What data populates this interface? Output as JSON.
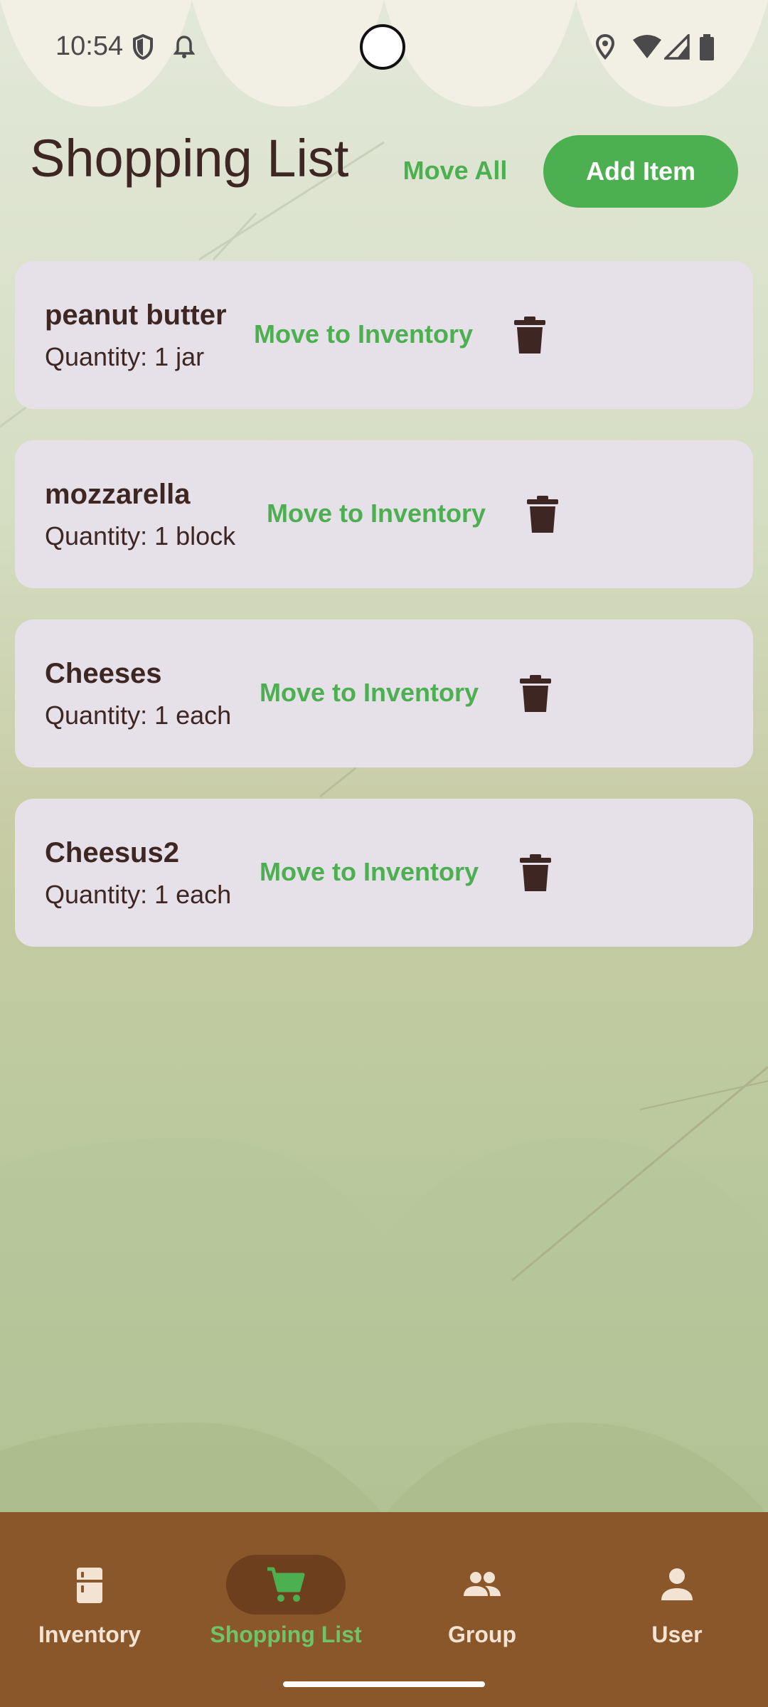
{
  "status_bar": {
    "time": "10:54",
    "icons": [
      "shield-icon",
      "bell-icon",
      "location-icon",
      "wifi-icon",
      "signal-icon",
      "battery-icon"
    ]
  },
  "header": {
    "title": "Shopping List",
    "move_all_label": "Move All",
    "add_item_label": "Add Item"
  },
  "items": [
    {
      "name": "peanut butter",
      "quantity": "Quantity: 1 jar",
      "move_label": "Move to Inventory"
    },
    {
      "name": "mozzarella",
      "quantity": "Quantity: 1 block",
      "move_label": "Move to Inventory"
    },
    {
      "name": "Cheeses",
      "quantity": "Quantity: 1 each",
      "move_label": "Move to Inventory"
    },
    {
      "name": "Cheesus2",
      "quantity": "Quantity: 1 each",
      "move_label": "Move to Inventory"
    }
  ],
  "nav": {
    "items": [
      {
        "label": "Inventory",
        "icon": "fridge-icon",
        "active": false
      },
      {
        "label": "Shopping List",
        "icon": "cart-icon",
        "active": true
      },
      {
        "label": "Group",
        "icon": "group-icon",
        "active": false
      },
      {
        "label": "User",
        "icon": "user-icon",
        "active": false
      }
    ]
  },
  "colors": {
    "accent_green": "#4caf50",
    "text_dark": "#3e2723",
    "card_bg": "#e6e0e8",
    "nav_bg": "#8a572b",
    "nav_active_pill": "#6e3f1c"
  }
}
